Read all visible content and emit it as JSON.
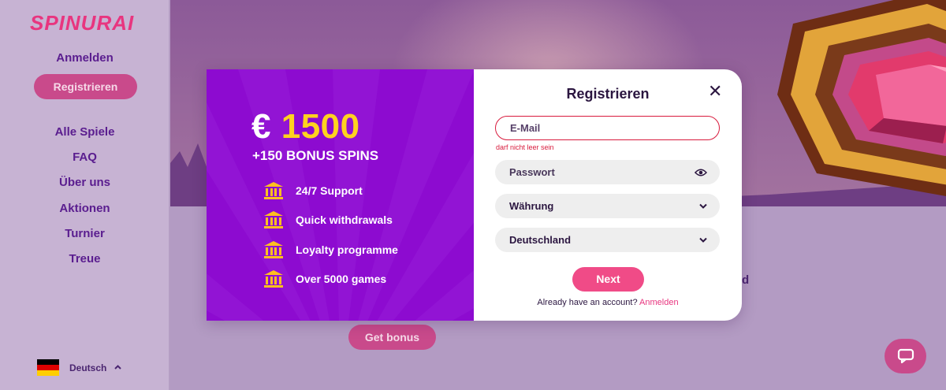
{
  "brand": {
    "logo": "SPINURAI"
  },
  "sidebar": {
    "login": "Anmelden",
    "register": "Registrieren",
    "items": [
      {
        "label": "Alle Spiele"
      },
      {
        "label": "FAQ"
      },
      {
        "label": "Über uns"
      },
      {
        "label": "Aktionen"
      },
      {
        "label": "Turnier"
      },
      {
        "label": "Treue"
      }
    ],
    "language": {
      "label": "Deutsch",
      "flag_colors": [
        "#000000",
        "#dd0000",
        "#ffce00"
      ]
    }
  },
  "background": {
    "partial_text": "d",
    "get_bonus": "Get bonus"
  },
  "modal": {
    "promo": {
      "currency": "€",
      "amount": "1500",
      "spins": "+150 BONUS SPINS",
      "features": [
        {
          "icon": "bank-icon",
          "label": "24/7 Support"
        },
        {
          "icon": "bank-icon",
          "label": "Quick withdrawals"
        },
        {
          "icon": "bank-icon",
          "label": "Loyalty programme"
        },
        {
          "icon": "bank-icon",
          "label": "Over 5000 games"
        }
      ]
    },
    "form": {
      "title": "Registrieren",
      "email_placeholder": "E-Mail",
      "email_error": "darf nicht leer sein",
      "password_placeholder": "Passwort",
      "currency_select": "Währung",
      "country_select": "Deutschland",
      "next": "Next",
      "already_text": "Already have an account?",
      "login_link": "Anmelden"
    }
  },
  "colors": {
    "accent_pink": "#e8357f",
    "promo_purple": "#8d0bd0",
    "gold": "#ffd21f",
    "error_red": "#d81b3d"
  }
}
